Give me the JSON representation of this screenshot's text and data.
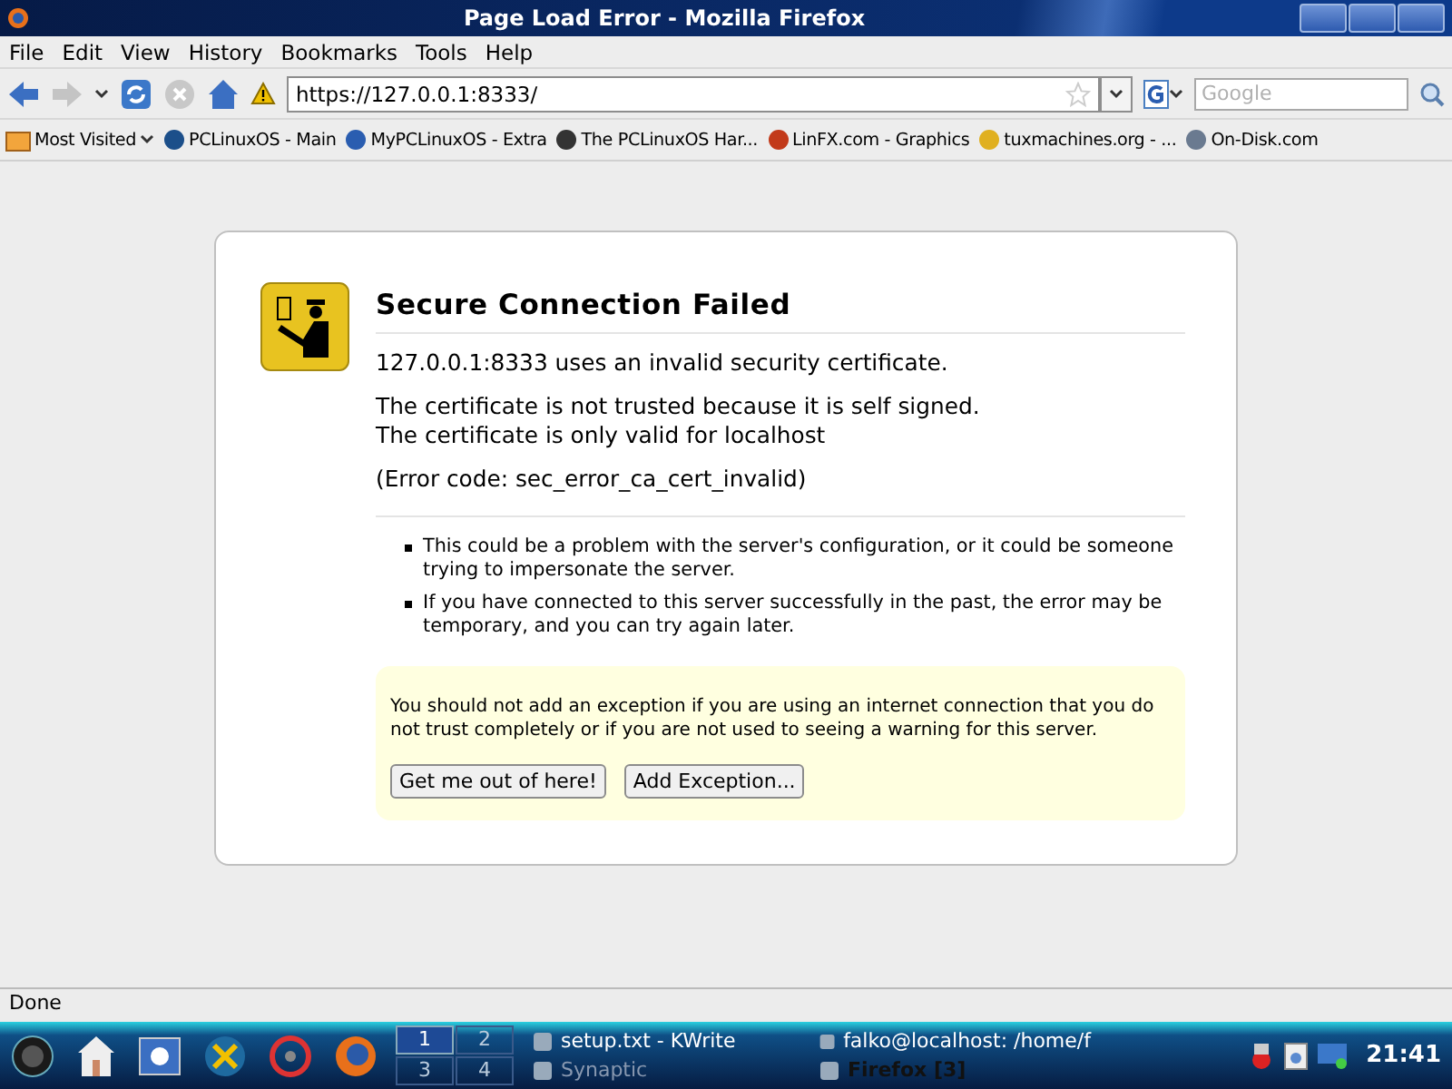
{
  "window": {
    "title": "Page Load Error - Mozilla Firefox"
  },
  "menu": [
    "File",
    "Edit",
    "View",
    "History",
    "Bookmarks",
    "Tools",
    "Help"
  ],
  "navigation": {
    "back_disabled": false,
    "forward_disabled": true,
    "stop_disabled": true,
    "url": "https://127.0.0.1:8333/",
    "search_placeholder": "Google"
  },
  "bookmarks": {
    "folder": "Most Visited",
    "items": [
      "PCLinuxOS - Main",
      "MyPCLinuxOS - Extra",
      "The PCLinuxOS Har...",
      "LinFX.com - Graphics",
      "tuxmachines.org - ...",
      "On-Disk.com"
    ]
  },
  "error_page": {
    "title": "Secure Connection Failed",
    "paragraphs": [
      "127.0.0.1:8333 uses an invalid security certificate.",
      "The certificate is not trusted because it is self signed.\nThe certificate is only valid for localhost",
      "(Error code: sec_error_ca_cert_invalid)"
    ],
    "bullets": [
      "This could be a problem with the server's configuration, or it could be someone trying to impersonate the server.",
      "If you have connected to this server successfully in the past, the error may be temporary, and you can try again later."
    ],
    "warning": "You should not add an exception if you are using an internet connection that you do not trust completely or if you are not used to seeing a warning for this server.",
    "buttons": [
      "Get me out of here!",
      "Add Exception..."
    ]
  },
  "status_bar": "Done",
  "taskbar": {
    "desktops": [
      {
        "label": "1",
        "selected": true
      },
      {
        "label": "2",
        "selected": false
      },
      {
        "label": "3",
        "selected": false
      },
      {
        "label": "4",
        "selected": false
      }
    ],
    "tasks": [
      {
        "label": "setup.txt - KWrite",
        "active": false,
        "minimized": false
      },
      {
        "label": "falko@localhost: /home/f",
        "active": false,
        "minimized": false
      },
      {
        "label": "Synaptic",
        "active": false,
        "minimized": true
      },
      {
        "label": "Firefox [3]",
        "active": true,
        "minimized": false
      }
    ],
    "clock": "21:41"
  }
}
